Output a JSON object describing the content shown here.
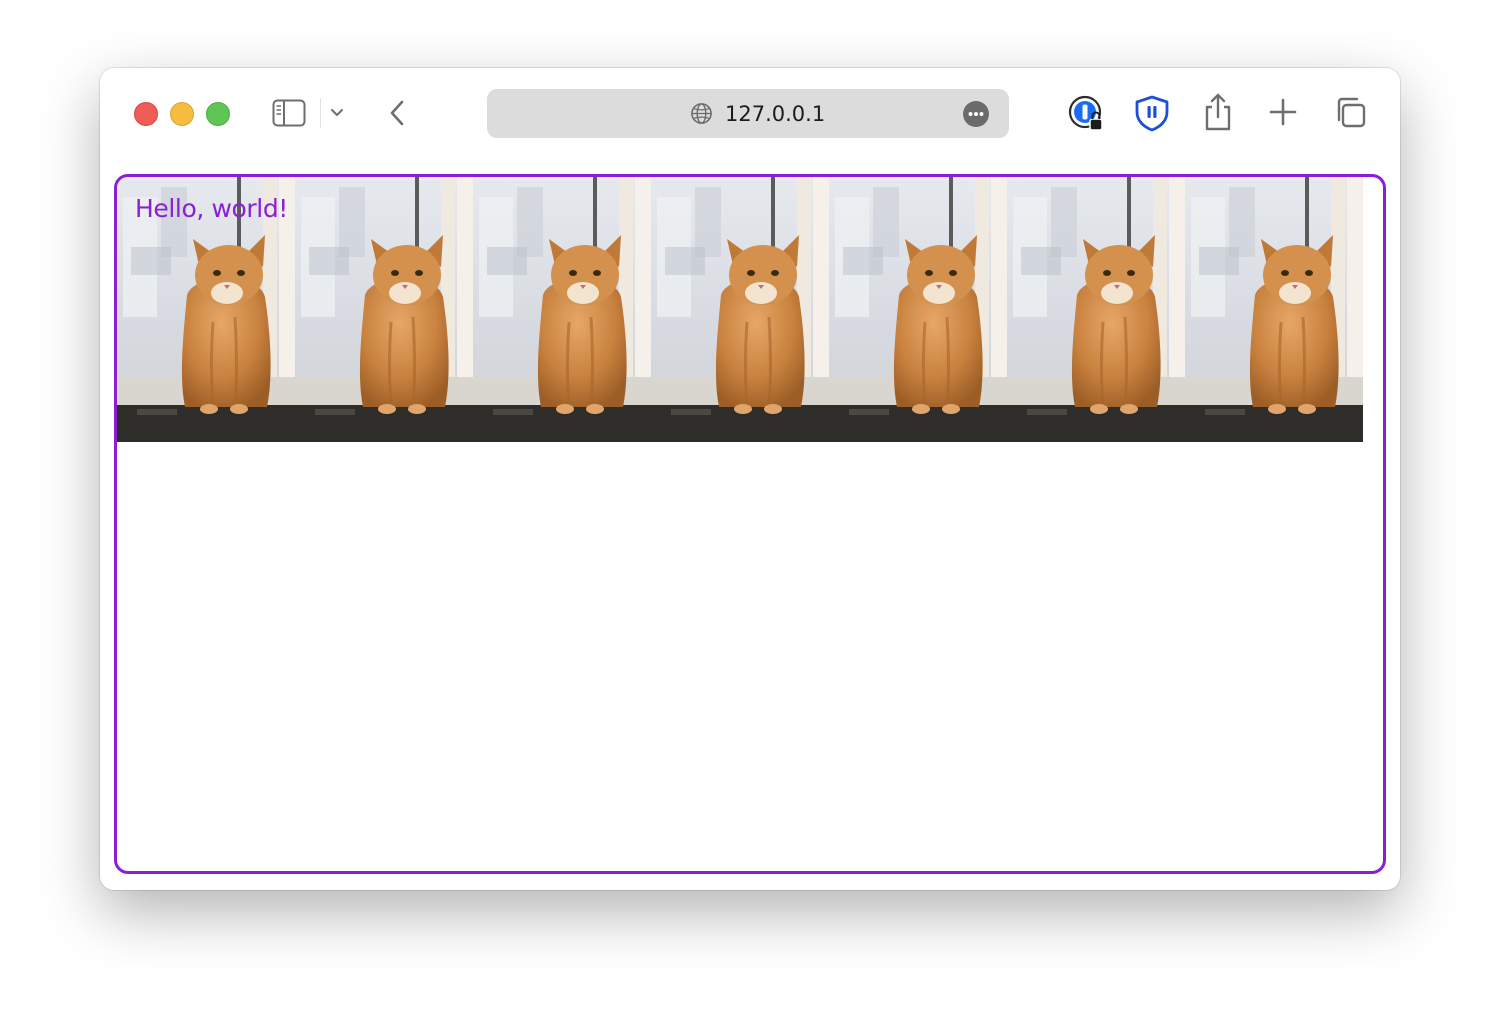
{
  "window": {
    "controls": [
      "close",
      "minimize",
      "maximize"
    ],
    "toolbar": {
      "icons": [
        "sidebar-icon",
        "chevron-down-icon",
        "back-arrow-icon",
        "globe-icon",
        "more-dots-icon",
        "password-manager-icon",
        "shield-extension-icon",
        "share-icon",
        "plus-icon",
        "tabs-overview-icon"
      ]
    },
    "address_bar": {
      "url": "127.0.0.1"
    }
  },
  "page": {
    "heading": "Hello, world!",
    "heading_color": "#8a1fd6",
    "frame_border_color": "#8a1fd6",
    "image_tile_count": 7,
    "image_subject": "cat-photo"
  }
}
